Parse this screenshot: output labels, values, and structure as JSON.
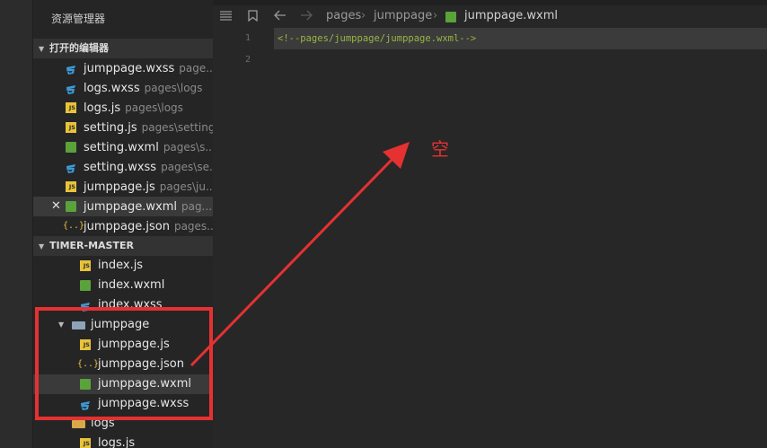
{
  "sidebar": {
    "title": "资源管理器",
    "open_editors": {
      "header": "打开的编辑器",
      "items": [
        {
          "name": "jumppage.wxss",
          "path": "page...",
          "type": "css"
        },
        {
          "name": "logs.wxss",
          "path": "pages\\logs",
          "type": "css"
        },
        {
          "name": "logs.js",
          "path": "pages\\logs",
          "type": "js"
        },
        {
          "name": "setting.js",
          "path": "pages\\setting",
          "type": "js"
        },
        {
          "name": "setting.wxml",
          "path": "pages\\s...",
          "type": "wxml"
        },
        {
          "name": "setting.wxss",
          "path": "pages\\se...",
          "type": "css"
        },
        {
          "name": "jumppage.js",
          "path": "pages\\ju...",
          "type": "js"
        },
        {
          "name": "jumppage.wxml",
          "path": "pag...",
          "type": "wxml",
          "active": true
        },
        {
          "name": "jumppage.json",
          "path": "pages...",
          "type": "json"
        }
      ]
    },
    "project": {
      "header": "TIMER-MASTER",
      "items": [
        {
          "name": "index.js",
          "type": "js"
        },
        {
          "name": "index.wxml",
          "type": "wxml"
        },
        {
          "name": "index.wxss",
          "type": "css"
        },
        {
          "name": "jumppage",
          "type": "folder"
        },
        {
          "name": "jumppage.js",
          "type": "js"
        },
        {
          "name": "jumppage.json",
          "type": "json"
        },
        {
          "name": "jumppage.wxml",
          "type": "wxml"
        },
        {
          "name": "jumppage.wxss",
          "type": "css"
        },
        {
          "name": "logs",
          "type": "folder-closed"
        },
        {
          "name": "logs.js",
          "type": "js"
        }
      ]
    }
  },
  "editor": {
    "breadcrumb": [
      "pages",
      "jumppage",
      "jumppage.wxml"
    ],
    "lines": [
      {
        "number": "1",
        "text": "<!--pages/jumppage/jumppage.wxml-->"
      },
      {
        "number": "2",
        "text": ""
      }
    ]
  },
  "annotation": {
    "text": "空",
    "color": "#e63131"
  },
  "icons": {
    "list": "list-icon",
    "bookmark": "bookmark-icon",
    "back": "arrow-left-icon",
    "forward": "arrow-right-icon",
    "chevron": "chevron-right-icon"
  },
  "js_icon_label": "JS",
  "json_icon_label": "{..}",
  "close_glyph": "✕"
}
